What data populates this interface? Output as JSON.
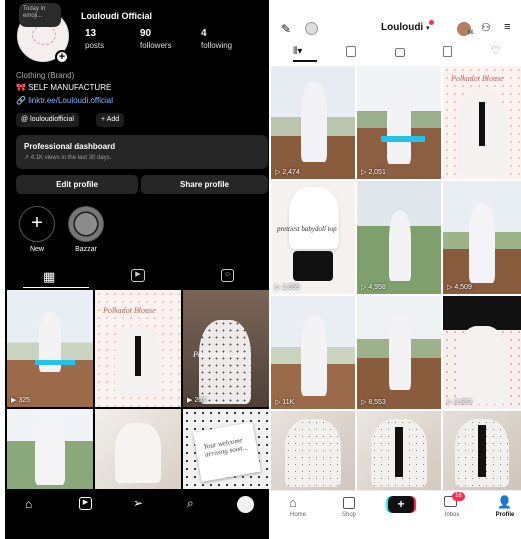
{
  "instagram": {
    "bubble_text": "Today in emoji...",
    "username": "Louloudi Official",
    "stats": [
      {
        "value": "13",
        "label": "posts"
      },
      {
        "value": "90",
        "label": "followers"
      },
      {
        "value": "4",
        "label": "following"
      }
    ],
    "category": "Clothing (Brand)",
    "bio": "🎀 SELF MANUFACTURE",
    "link": "linktr.ee/Louloudi.official",
    "threads_chip": "louloudiofficial",
    "add_chip": "+ Add",
    "dashboard": {
      "title": "Professional dashboard",
      "subtitle": "↗ 4.1K views in the last 30 days."
    },
    "edit_profile": "Edit profile",
    "share_profile": "Share profile",
    "highlights": [
      {
        "label": "New"
      },
      {
        "label": "Bazzar"
      }
    ],
    "grid_views": [
      "325",
      "204"
    ],
    "grid_captions": [
      "Polkadot Blouse",
      "Polkadot Blouse"
    ],
    "note_text": "Your welcome arriving soon..."
  },
  "tiktok": {
    "username": "Louloudi",
    "notif_count": "66",
    "tile_views": [
      "2,474",
      "2,051",
      "",
      "2,695",
      "4,958",
      "4,509",
      "11K",
      "8,553",
      "3,853",
      "",
      "",
      ""
    ],
    "tile_captions": [
      "",
      "",
      "Polkadot Blouse",
      "prettiest babydoll top",
      "",
      "",
      "",
      "",
      "",
      "",
      "",
      ""
    ],
    "nav": [
      {
        "label": "Home"
      },
      {
        "label": "Shop"
      },
      {
        "label": ""
      },
      {
        "label": "Inbox",
        "badge": "16"
      },
      {
        "label": "Profile"
      }
    ]
  },
  "colors": {
    "ig_bg": "#000000",
    "tt_accent": "#fe2c55",
    "link": "#8ab4ff"
  }
}
